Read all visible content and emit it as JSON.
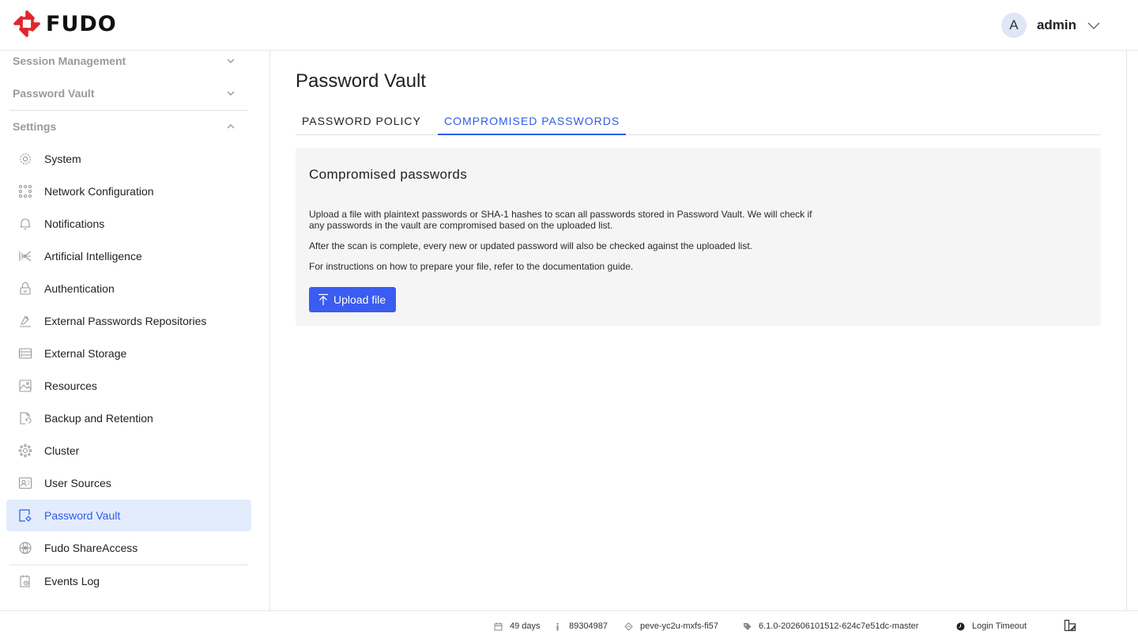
{
  "header": {
    "logo_text": "FUDO",
    "avatar_initial": "A",
    "username": "admin"
  },
  "sidebar": {
    "sections": [
      {
        "label": "Session Management",
        "expanded": false
      },
      {
        "label": "Password Vault",
        "expanded": false
      },
      {
        "label": "Settings",
        "expanded": true
      }
    ],
    "items": [
      {
        "label": "System",
        "icon": "gear-icon"
      },
      {
        "label": "Network Configuration",
        "icon": "network-icon"
      },
      {
        "label": "Notifications",
        "icon": "bell-icon"
      },
      {
        "label": "Artificial Intelligence",
        "icon": "ai-icon"
      },
      {
        "label": "Authentication",
        "icon": "lock-icon"
      },
      {
        "label": "External Passwords Repositories",
        "icon": "repository-icon"
      },
      {
        "label": "External Storage",
        "icon": "storage-icon"
      },
      {
        "label": "Resources",
        "icon": "resources-icon"
      },
      {
        "label": "Backup and Retention",
        "icon": "backup-icon"
      },
      {
        "label": "Cluster",
        "icon": "cluster-icon"
      },
      {
        "label": "User Sources",
        "icon": "user-sources-icon"
      },
      {
        "label": "Password Vault",
        "icon": "password-vault-icon",
        "active": true
      },
      {
        "label": "Fudo ShareAccess",
        "icon": "share-access-icon"
      },
      {
        "label": "Events Log",
        "icon": "events-log-icon"
      }
    ]
  },
  "main": {
    "title": "Password Vault",
    "tabs": [
      {
        "label": "PASSWORD POLICY",
        "active": false
      },
      {
        "label": "COMPROMISED PASSWORDS",
        "active": true
      }
    ],
    "panel": {
      "title": "Compromised passwords",
      "paragraphs": [
        "Upload a file with plaintext passwords or SHA-1 hashes to scan all passwords stored in Password Vault. We will check if any passwords in the vault are compromised based on the uploaded list.",
        "After the scan is complete, every new or updated password will also be checked against the uploaded list.",
        "For instructions on how to prepare your file, refer to the documentation guide."
      ],
      "upload_label": "Upload file"
    }
  },
  "footer": {
    "uptime": "49 days",
    "serial": "89304987",
    "hostname": "peve-yc2u-mxfs-fi57",
    "version": "6.1.0-202606101512-624c7e51dc-master",
    "login_timeout": "Login Timeout"
  },
  "colors": {
    "accent": "#2e5be5",
    "button": "#3a5cf0",
    "active_bg": "#e3ecfd",
    "panel_bg": "#f5f5f5",
    "logo_red": "#e0262d"
  }
}
